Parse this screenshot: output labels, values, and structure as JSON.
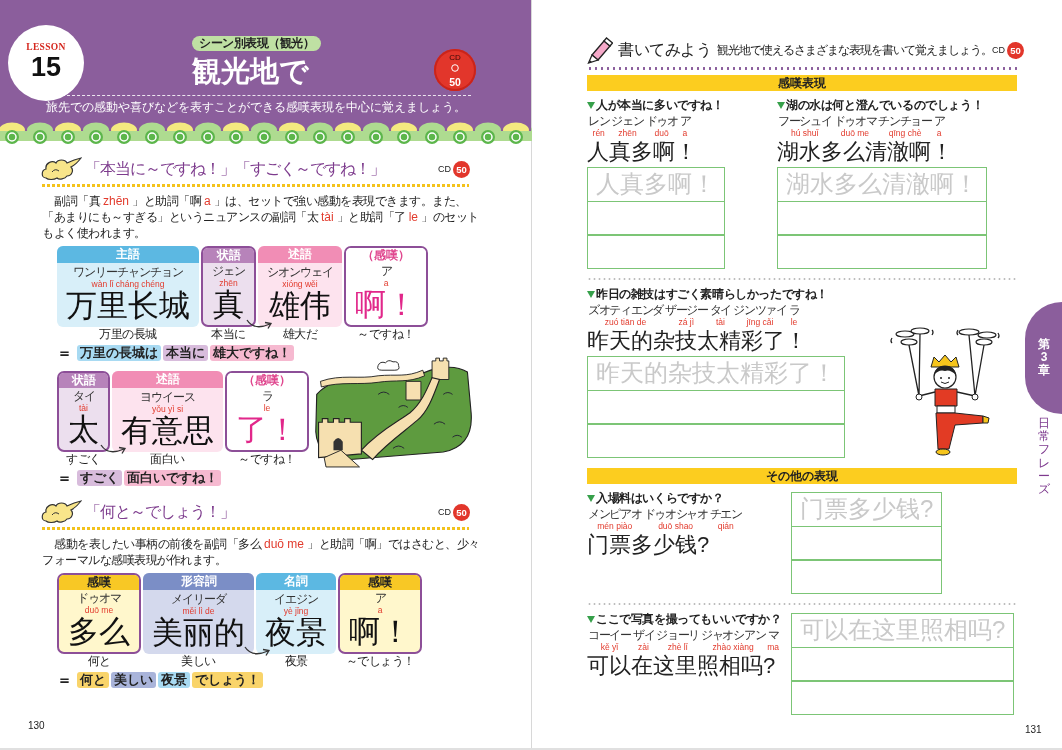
{
  "left_page": {
    "header": {
      "lesson_label": "LESSON",
      "lesson_number": "15",
      "category": "シーン別表現（観光）",
      "title": "観光地で",
      "cd_label": "CD",
      "cd_track": "50",
      "subtitle": "旅先での感動や喜びなどを表すことができる感嘆表現を中心に覚えましょう。"
    },
    "sections": [
      {
        "heading": "「本当に～ですね！」「すごく～ですね！」",
        "cd_label": "CD",
        "cd_track": "50",
        "paragraph": [
          {
            "kind": "text",
            "text": "副詞「真"
          },
          {
            "kind": "pinyin",
            "text": "zhēn"
          },
          {
            "kind": "text",
            "text": "」と助詞「啊"
          },
          {
            "kind": "pinyin",
            "text": "a"
          },
          {
            "kind": "text",
            "text": "」は、セットで強い感動を表現できます。また、「あまりにも～すぎる」というニュアンスの副詞「太"
          },
          {
            "kind": "pinyin",
            "text": "tài"
          },
          {
            "kind": "text",
            "text": "」と助詞「了"
          },
          {
            "kind": "pinyin",
            "text": "le"
          },
          {
            "kind": "text",
            "text": "」のセットもよく使われます。"
          }
        ],
        "diagrams": [
          {
            "blocks": [
              {
                "kind": "subject",
                "role": "主語",
                "kana": "ワンリーチャンチョン",
                "pinyin": "wàn lǐ cháng chéng",
                "hanzi": "万里长城",
                "gloss": "万里の長城",
                "modifies_next": false
              },
              {
                "kind": "adverb",
                "role": "状語",
                "kana": "ジェン",
                "pinyin": "zhēn",
                "hanzi": "真",
                "gloss": "本当に",
                "modifies_next": true
              },
              {
                "kind": "predicate",
                "role": "述語",
                "kana": "シオンウェイ",
                "pinyin": "xióng wěi",
                "hanzi": "雄伟",
                "gloss": "雄大だ",
                "modifies_next": false
              },
              {
                "kind": "particle",
                "role": "（感嘆）",
                "kana": "ア",
                "pinyin": "a",
                "hanzi": "啊！",
                "gloss": "～ですね！",
                "modifies_next": false
              }
            ],
            "equals": "＝",
            "chips": [
              {
                "kind": "subject",
                "text": "万里の長城は"
              },
              {
                "kind": "adverb",
                "text": "本当に"
              },
              {
                "kind": "predicate",
                "text": "雄大ですね！"
              }
            ]
          },
          {
            "blocks": [
              {
                "kind": "adverb",
                "role": "状語",
                "kana": "タイ",
                "pinyin": "tài",
                "hanzi": "太",
                "gloss": "すごく",
                "modifies_next": true
              },
              {
                "kind": "predicate",
                "role": "述語",
                "kana": "ヨウイース",
                "pinyin": "yǒu yì si",
                "hanzi": "有意思",
                "gloss": "面白い",
                "modifies_next": false
              },
              {
                "kind": "particle",
                "role": "（感嘆）",
                "kana": "ラ",
                "pinyin": "le",
                "hanzi": "了！",
                "gloss": "～ですね！",
                "modifies_next": false
              }
            ],
            "equals": "＝",
            "chips": [
              {
                "kind": "adverb",
                "text": "すごく"
              },
              {
                "kind": "predicate",
                "text": "面白いですね！"
              }
            ]
          }
        ]
      },
      {
        "heading": "「何と～でしょう！」",
        "cd_label": "CD",
        "cd_track": "50",
        "paragraph": [
          {
            "kind": "text",
            "text": "感動を表したい事柄の前後を副詞「多么"
          },
          {
            "kind": "pinyin",
            "text": "duō me"
          },
          {
            "kind": "text",
            "text": "」と助詞「啊」ではさむと、少々フォーマルな感嘆表現が作れます。"
          }
        ],
        "diagrams": [
          {
            "blocks": [
              {
                "kind": "exclamation",
                "role": "感嘆",
                "kana": "ドゥオマ",
                "pinyin": "duō me",
                "hanzi": "多么",
                "gloss": "何と",
                "modifies_next": false
              },
              {
                "kind": "adjective",
                "role": "形容詞",
                "kana": "メイリーダ",
                "pinyin": "měi lì de",
                "hanzi": "美丽的",
                "gloss": "美しい",
                "modifies_next": true
              },
              {
                "kind": "noun",
                "role": "名詞",
                "kana": "イエジン",
                "pinyin": "yè jǐng",
                "hanzi": "夜景",
                "gloss": "夜景",
                "modifies_next": false
              },
              {
                "kind": "exclamation",
                "role": "感嘆",
                "kana": "ア",
                "pinyin": "a",
                "hanzi": "啊！",
                "gloss": "～でしょう！",
                "modifies_next": false
              }
            ],
            "equals": "＝",
            "chips": [
              {
                "kind": "exclamation",
                "text": "何と"
              },
              {
                "kind": "adjective",
                "text": "美しい"
              },
              {
                "kind": "noun",
                "text": "夜景"
              },
              {
                "kind": "exclamation",
                "text": "でしょう！"
              }
            ]
          }
        ]
      }
    ],
    "page_number": "130"
  },
  "right_page": {
    "header": {
      "title": "書いてみよう",
      "subtitle": "観光地で使えるさまざまな表現を書いて覚えましょう。",
      "cd_label": "CD",
      "cd_track": "50"
    },
    "sections": [
      {
        "heading": "感嘆表現",
        "rows": [
          {
            "items": [
              {
                "kind": "stacked",
                "prompt": "人が本当に多いですね！",
                "ruby": [
                  {
                    "kana": "レン",
                    "pinyin": "rén"
                  },
                  {
                    "kana": "ジェン",
                    "pinyin": "zhēn"
                  },
                  {
                    "kana": "ドゥオ",
                    "pinyin": "duō"
                  },
                  {
                    "kana": "ア",
                    "pinyin": "a"
                  }
                ],
                "hanzi": "人真多啊！",
                "trace_text": "人真多啊！"
              },
              {
                "kind": "stacked",
                "prompt": "湖の水は何と澄んでいるのでしょう！",
                "ruby": [
                  {
                    "kana": "フーシュイ",
                    "pinyin": "hú shuǐ"
                  },
                  {
                    "kana": "ドゥオマ",
                    "pinyin": "duō me"
                  },
                  {
                    "kana": "チンチョー",
                    "pinyin": "qīng chè"
                  },
                  {
                    "kana": "ア",
                    "pinyin": "a"
                  }
                ],
                "hanzi": "湖水多么清澈啊！",
                "trace_text": "湖水多么清澈啊！"
              }
            ]
          },
          {
            "items": [
              {
                "kind": "stacked",
                "prompt": "昨日の雑技はすごく素晴らしかったですね！",
                "ruby": [
                  {
                    "kana": "ズオティエンダ",
                    "pinyin": "zuó tiān de"
                  },
                  {
                    "kana": "ザージー",
                    "pinyin": "zá jì"
                  },
                  {
                    "kana": "タイ",
                    "pinyin": "tài"
                  },
                  {
                    "kana": "ジンツァイ",
                    "pinyin": "jīng cǎi"
                  },
                  {
                    "kana": "ラ",
                    "pinyin": "le"
                  }
                ],
                "hanzi": "昨天的杂技太精彩了！",
                "trace_text": "昨天的杂技太精彩了！"
              }
            ]
          }
        ]
      },
      {
        "heading": "その他の表現",
        "rows": [
          {
            "items": [
              {
                "kind": "beside",
                "prompt": "入場料はいくらですか？",
                "ruby": [
                  {
                    "kana": "メンピアオ",
                    "pinyin": "mén piào"
                  },
                  {
                    "kana": "ドゥオシャオ",
                    "pinyin": "duō shao"
                  },
                  {
                    "kana": "チエン",
                    "pinyin": "qián"
                  }
                ],
                "hanzi": "门票多少钱?",
                "trace_text": "门票多少钱?"
              }
            ]
          },
          {
            "items": [
              {
                "kind": "beside",
                "prompt": "ここで写真を撮ってもいいですか？",
                "ruby": [
                  {
                    "kana": "コーイー",
                    "pinyin": "kě yǐ"
                  },
                  {
                    "kana": "ザイ",
                    "pinyin": "zài"
                  },
                  {
                    "kana": "ジョーリ",
                    "pinyin": "zhè lǐ"
                  },
                  {
                    "kana": "ジャオシアン",
                    "pinyin": "zhào xiàng"
                  },
                  {
                    "kana": "マ",
                    "pinyin": "ma"
                  }
                ],
                "hanzi": "可以在这里照相吗?",
                "trace_text": "可以在这里照相吗?"
              }
            ]
          }
        ]
      }
    ],
    "chapter_tab": {
      "label": "第3章",
      "title": "日常フレーズ"
    },
    "page_number": "131"
  }
}
